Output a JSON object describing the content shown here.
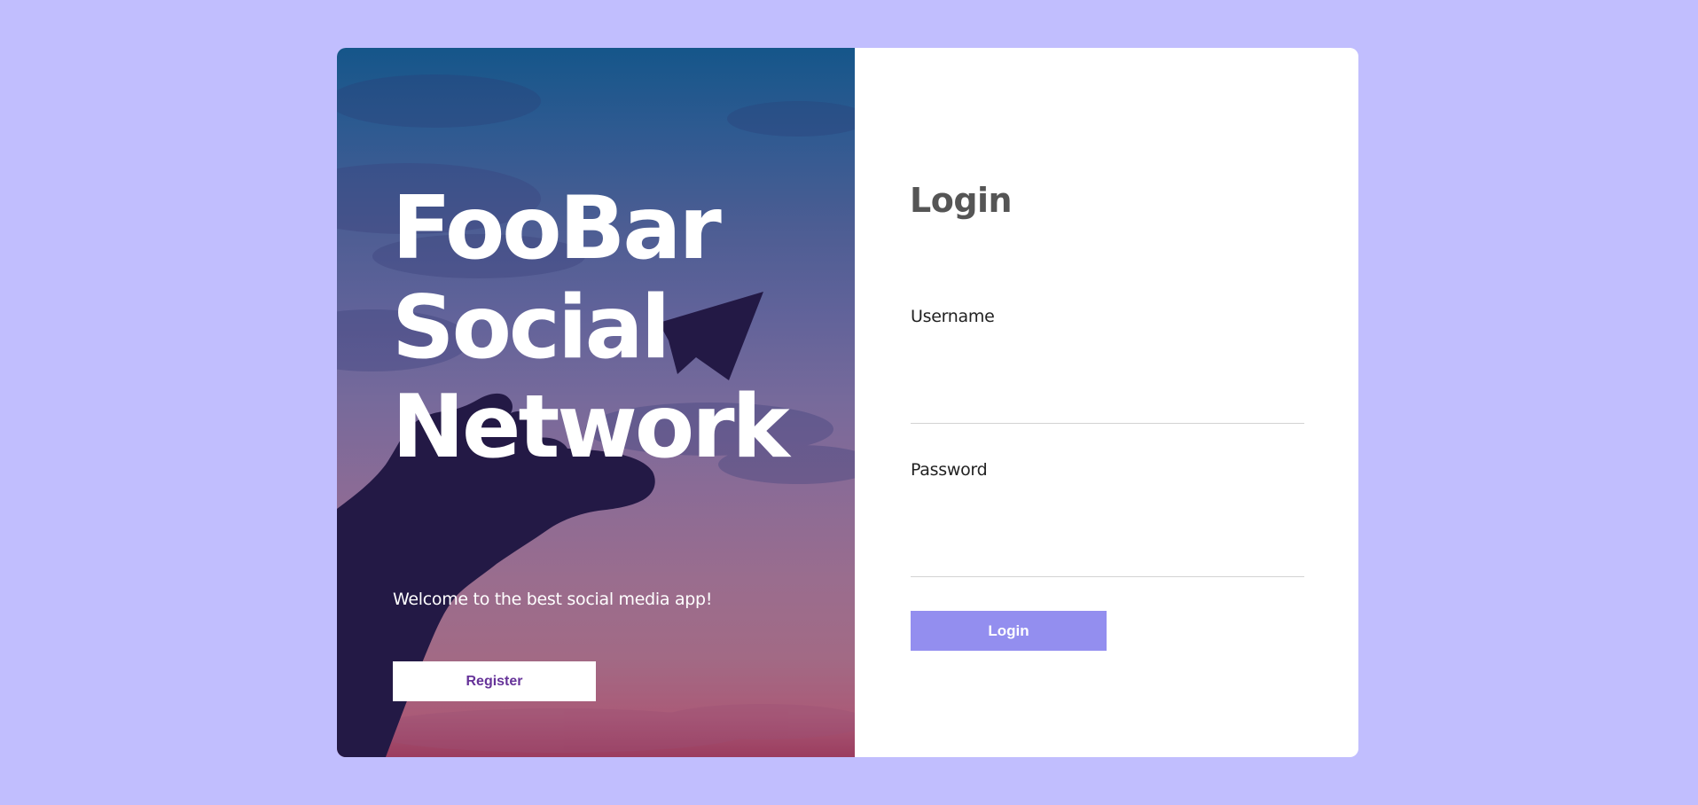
{
  "hero": {
    "title_line1": "FooBar",
    "title_line2": "Social",
    "title_line3": "Network",
    "welcome": "Welcome to the best social media app!",
    "register_label": "Register"
  },
  "login": {
    "title": "Login",
    "username_label": "Username",
    "username_value": "",
    "password_label": "Password",
    "password_value": "",
    "submit_label": "Login"
  },
  "colors": {
    "page_background": "#c1befe",
    "login_button": "#938eef",
    "register_text": "#663399",
    "silhouette": "#231945"
  },
  "icons": {
    "hero_image": "hand-releasing-paper-plane-sunset"
  }
}
